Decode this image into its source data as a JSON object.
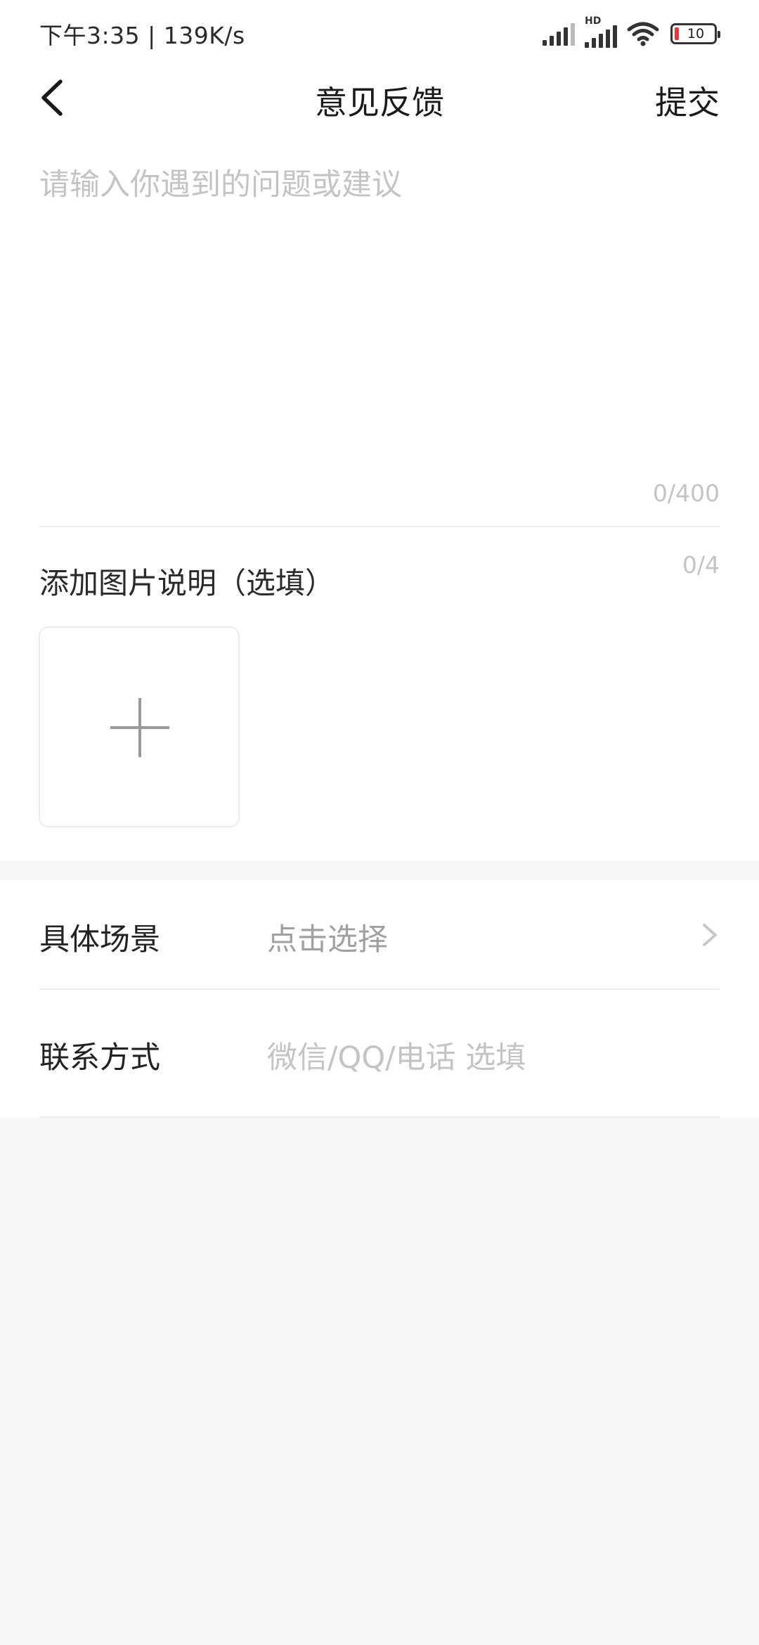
{
  "status_bar": {
    "time_speed": "下午3:35 | 139K/s",
    "hd_label": "HD",
    "battery_level": "10",
    "battery_color": "#e53935",
    "icons": [
      "signal-icon",
      "hd-signal-icon",
      "wifi-icon",
      "battery-icon"
    ]
  },
  "header": {
    "title": "意见反馈",
    "submit_label": "提交",
    "back_icon": "chevron-left-icon"
  },
  "feedback": {
    "placeholder": "请输入你遇到的问题或建议",
    "char_count": "0/400"
  },
  "images": {
    "label": "添加图片说明（选填）",
    "count": "0/4",
    "add_icon": "plus-icon"
  },
  "scene": {
    "label": "具体场景",
    "value": "点击选择",
    "chevron_icon": "chevron-right-icon"
  },
  "contact": {
    "label": "联系方式",
    "placeholder": "微信/QQ/电话 选填"
  }
}
